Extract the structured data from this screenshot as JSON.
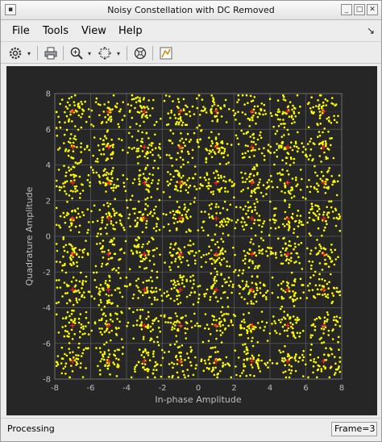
{
  "window": {
    "title": "Noisy Constellation with DC Removed"
  },
  "menu": {
    "file": "File",
    "tools": "Tools",
    "view": "View",
    "help": "Help"
  },
  "toolbar": {
    "buttons": [
      "settings-icon",
      "print-icon",
      "zoom-in-icon",
      "zoom-fit-icon",
      "reset-axes-icon",
      "style-icon"
    ]
  },
  "status": {
    "text": "Processing",
    "frame": "Frame=3"
  },
  "colors": {
    "background": "#262626",
    "points": "#ffff00",
    "reference": "#ff2020",
    "grid": "#5a5a5a",
    "axis_text": "#bfbfbf"
  },
  "chart_data": {
    "type": "scatter",
    "title": "",
    "xlabel": "In-phase Amplitude",
    "ylabel": "Quadrature Amplitude",
    "xlim": [
      -8,
      8
    ],
    "ylim": [
      -8,
      8
    ],
    "xticks": [
      -8,
      -6,
      -4,
      -2,
      0,
      2,
      4,
      6,
      8
    ],
    "yticks": [
      -8,
      -6,
      -4,
      -2,
      0,
      2,
      4,
      6,
      8
    ],
    "grid": true,
    "constellation": "64-QAM",
    "reference_levels": [
      -7,
      -5,
      -3,
      -1,
      1,
      3,
      5,
      7
    ],
    "noise_spread": 0.5,
    "points_per_symbol": 45,
    "series": [
      {
        "values": "noisy received symbols around each reference point",
        "color": "#ffff00"
      },
      {
        "values": "ideal reference constellation (+ markers)",
        "color": "#ff2020"
      }
    ]
  }
}
